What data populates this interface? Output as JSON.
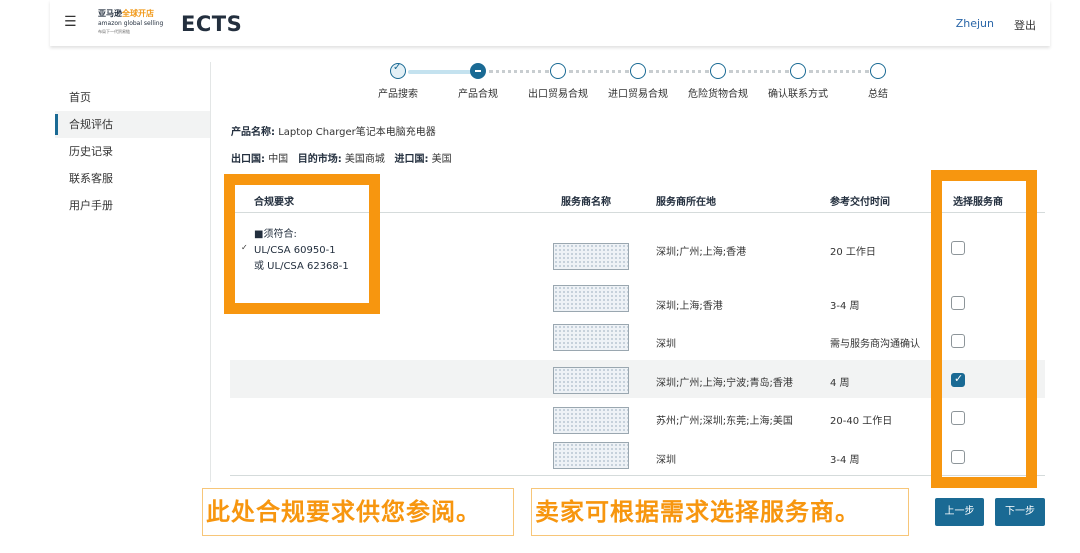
{
  "header": {
    "menu_icon": "hamburger-icon",
    "logo_line1_a": "亚马逊",
    "logo_line1_b": "全球开店",
    "logo_line2": "amazon global selling",
    "logo_line3": "布局下一代贸易链",
    "app_title": "ECTS",
    "user": "Zhejun",
    "logout": "登出"
  },
  "sidebar": {
    "items": [
      {
        "label": "首页"
      },
      {
        "label": "合规评估"
      },
      {
        "label": "历史记录"
      },
      {
        "label": "联系客服"
      },
      {
        "label": "用户手册"
      }
    ]
  },
  "stepper": {
    "steps": [
      {
        "label": "产品搜索",
        "state": "done"
      },
      {
        "label": "产品合规",
        "state": "current"
      },
      {
        "label": "出口贸易合规",
        "state": "todo"
      },
      {
        "label": "进口贸易合规",
        "state": "todo"
      },
      {
        "label": "危险货物合规",
        "state": "todo"
      },
      {
        "label": "确认联系方式",
        "state": "todo"
      },
      {
        "label": "总结",
        "state": "todo"
      }
    ]
  },
  "product": {
    "name_label": "产品名称:",
    "name_value": "Laptop Charger笔记本电脑充电器",
    "export_label": "出口国:",
    "export_value": "中国",
    "market_label": "目的市场:",
    "market_value": "美国商城",
    "import_label": "进口国:",
    "import_value": "美国"
  },
  "table": {
    "headers": {
      "requirement": "合规要求",
      "provider_name": "服务商名称",
      "provider_location": "服务商所在地",
      "delivery_time": "参考交付时间",
      "select": "选择服务商"
    },
    "requirement_lines": [
      "■须符合:",
      "UL/CSA 60950-1",
      "或 UL/CSA 62368-1"
    ],
    "requirement_mark": "✓",
    "rows": [
      {
        "location": "深圳;广州;上海;香港",
        "time": "20 工作日",
        "checked": false
      },
      {
        "location": "深圳;上海;香港",
        "time": "3-4 周",
        "checked": false
      },
      {
        "location": "深圳",
        "time": "需与服务商沟通确认",
        "checked": false
      },
      {
        "location": "深圳;广州;上海;宁波;青岛;香港",
        "time": "4 周",
        "checked": true
      },
      {
        "location": "苏州;广州;深圳;东莞;上海;美国",
        "time": "20-40 工作日",
        "checked": false
      },
      {
        "location": "深圳",
        "time": "3-4 周",
        "checked": false
      }
    ]
  },
  "annotations": {
    "note_left": "此处合规要求供您参阅。",
    "note_right": "卖家可根据需求选择服务商。",
    "highlight_color": "#f7960f"
  },
  "buttons": {
    "prev": "上一步",
    "next": "下一步"
  },
  "colors": {
    "primary": "#1a6a94",
    "link": "#2a66a8",
    "accent_orange": "#f7960f"
  }
}
